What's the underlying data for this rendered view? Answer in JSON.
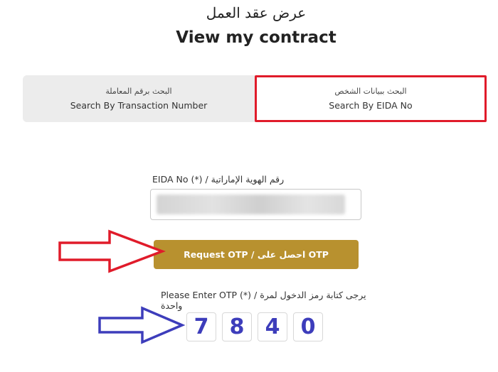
{
  "header": {
    "title_ar": "عرض عقد العمل",
    "title_en": "View my contract"
  },
  "tabs": [
    {
      "label_ar": "البحث برقم المعاملة",
      "label_en": "Search By Transaction Number",
      "active": false
    },
    {
      "label_ar": "البحث ببيانات الشخص",
      "label_en": "Search By EIDA No",
      "active": true
    }
  ],
  "eida": {
    "label": "EIDA No (*) / رقم الهوية الإماراتية",
    "value": ""
  },
  "otp_button": {
    "label": "Request OTP / احصل على OTP"
  },
  "otp": {
    "label": "Please Enter OTP (*) / يرجى كتابة رمز الدخول لمرة واحدة",
    "digits": [
      "7",
      "8",
      "4",
      "0"
    ]
  },
  "colors": {
    "highlight_red": "#e01b2a",
    "annotation_blue": "#3d3dbb",
    "button_gold": "#b8912f",
    "tab_bg": "#ececec"
  }
}
